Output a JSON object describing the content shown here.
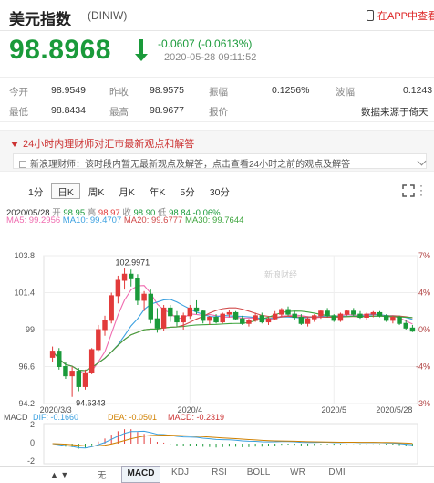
{
  "header": {
    "title": "美元指数",
    "code": "(DINIW)",
    "app_link": "在APP中查看"
  },
  "quote": {
    "price": "98.8968",
    "change": "-0.0607 (-0.0613%)",
    "time": "2020-05-28 09:11:52"
  },
  "stats": [
    {
      "label": "今开",
      "value": "98.9549"
    },
    {
      "label": "昨收",
      "value": "98.9575"
    },
    {
      "label": "振幅",
      "value": "0.1256%"
    },
    {
      "label": "波幅",
      "value": "0.1243"
    },
    {
      "label": "最低",
      "value": "98.8434"
    },
    {
      "label": "最高",
      "value": "98.9677"
    },
    {
      "label": "报价",
      "value": "数据来源于倚天"
    }
  ],
  "news": {
    "header": "24小时内理财师对汇市最新观点和解答",
    "row": "新浪理财师：该时段内暂无最新观点及解答，点击查看24小时之前的观点及解答"
  },
  "tabs": [
    "1分",
    "日K",
    "周K",
    "月K",
    "年K",
    "5分",
    "30分"
  ],
  "info": {
    "date": "2020/05/28",
    "open_label": "开",
    "open": "98.95",
    "high_label": "高",
    "high": "98.97",
    "close_label": "收",
    "close": "98.90",
    "low_label": "低",
    "low": "98.84",
    "pct": "-0.06%",
    "ma5": "MA5: 99.2956",
    "ma10": "MA10: 99.4707",
    "ma20": "MA20: 99.6777",
    "ma30": "MA30: 99.7644"
  },
  "macd": {
    "label": "MACD",
    "dif": "DIF: -0.1660",
    "dea": "DEA: -0.0501",
    "macd": "MACD: -0.2319"
  },
  "watermark": "新浪财经",
  "bottom": {
    "nav": "▲ ▼",
    "buttons": [
      "无",
      "MACD",
      "KDJ",
      "RSI",
      "BOLL",
      "WR",
      "DMI"
    ]
  },
  "colors": {
    "up": "#e23b3b",
    "down": "#1a9a3a",
    "ma5": "#f06cb0",
    "ma10": "#3aa0e0",
    "ma20": "#d14b4b",
    "ma30": "#3fa53f"
  },
  "chart_data": {
    "type": "candlestick",
    "y_ticks": [
      "103.8",
      "101.4",
      "99",
      "96.6",
      "94.2"
    ],
    "pct_ticks": [
      "7%",
      "4%",
      "0%",
      "-4%",
      "-3%"
    ],
    "x_ticks": [
      "2020/3/3",
      "2020/4",
      "2020/5",
      "2020/5/28"
    ],
    "annotations": [
      "102.9971",
      "94.6343"
    ],
    "ylim": [
      94.2,
      103.8
    ],
    "macd_ticks": [
      "2",
      "0",
      "-2"
    ],
    "ohlc": [
      [
        97.2,
        97.9,
        96.9,
        97.6
      ],
      [
        97.6,
        97.8,
        96.4,
        96.6
      ],
      [
        96.6,
        96.9,
        95.8,
        96.0
      ],
      [
        96.0,
        96.6,
        94.63,
        96.3
      ],
      [
        96.3,
        96.5,
        95.0,
        95.3
      ],
      [
        95.3,
        96.4,
        95.1,
        96.2
      ],
      [
        96.2,
        97.8,
        96.1,
        97.7
      ],
      [
        97.7,
        99.3,
        97.6,
        99.0
      ],
      [
        99.0,
        99.9,
        98.6,
        99.6
      ],
      [
        99.6,
        101.4,
        99.4,
        101.2
      ],
      [
        101.2,
        102.5,
        100.7,
        102.2
      ],
      [
        102.2,
        102.99,
        101.6,
        102.6
      ],
      [
        102.6,
        102.9,
        101.8,
        102.3
      ],
      [
        102.3,
        102.6,
        100.6,
        100.9
      ],
      [
        100.9,
        101.5,
        100.2,
        101.3
      ],
      [
        101.3,
        101.6,
        99.4,
        99.7
      ],
      [
        99.7,
        100.4,
        98.8,
        99.1
      ],
      [
        99.1,
        100.6,
        98.9,
        100.4
      ],
      [
        100.4,
        100.6,
        99.5,
        99.9
      ],
      [
        99.9,
        100.2,
        99.2,
        99.5
      ],
      [
        99.5,
        100.1,
        99.0,
        99.9
      ],
      [
        99.9,
        100.6,
        99.7,
        100.4
      ],
      [
        100.4,
        100.9,
        100.0,
        100.2
      ],
      [
        100.2,
        100.3,
        99.4,
        99.6
      ],
      [
        99.6,
        99.9,
        99.3,
        99.8
      ],
      [
        99.8,
        100.0,
        99.4,
        99.5
      ],
      [
        99.5,
        100.1,
        99.4,
        100.0
      ],
      [
        100.0,
        100.3,
        99.8,
        100.1
      ],
      [
        100.1,
        100.2,
        99.6,
        99.7
      ],
      [
        99.7,
        99.9,
        99.3,
        99.4
      ],
      [
        99.4,
        99.7,
        99.2,
        99.6
      ],
      [
        99.6,
        100.1,
        99.5,
        99.9
      ],
      [
        99.9,
        100.1,
        99.4,
        99.5
      ],
      [
        99.5,
        99.8,
        99.3,
        99.7
      ],
      [
        99.7,
        100.2,
        99.6,
        100.0
      ],
      [
        100.0,
        100.4,
        99.8,
        100.3
      ],
      [
        100.3,
        100.5,
        99.9,
        100.0
      ],
      [
        100.0,
        100.2,
        99.6,
        99.8
      ],
      [
        99.8,
        100.0,
        99.3,
        99.4
      ],
      [
        99.4,
        99.8,
        99.2,
        99.7
      ],
      [
        99.7,
        100.0,
        99.5,
        99.9
      ],
      [
        99.9,
        100.3,
        99.7,
        100.2
      ],
      [
        100.2,
        100.4,
        99.8,
        99.9
      ],
      [
        99.9,
        100.0,
        99.5,
        99.6
      ],
      [
        99.6,
        100.1,
        99.5,
        100.0
      ],
      [
        100.0,
        100.3,
        99.9,
        100.2
      ],
      [
        100.2,
        100.4,
        99.9,
        100.0
      ],
      [
        100.0,
        100.2,
        99.7,
        99.8
      ],
      [
        99.8,
        100.1,
        99.6,
        100.0
      ],
      [
        100.0,
        100.2,
        99.8,
        100.1
      ],
      [
        100.1,
        100.2,
        99.8,
        99.9
      ],
      [
        99.9,
        100.0,
        99.5,
        99.6
      ],
      [
        99.6,
        99.9,
        99.4,
        99.8
      ],
      [
        99.8,
        99.9,
        99.3,
        99.4
      ],
      [
        99.4,
        99.6,
        99.0,
        99.1
      ],
      [
        99.1,
        99.3,
        98.84,
        98.9
      ]
    ]
  }
}
